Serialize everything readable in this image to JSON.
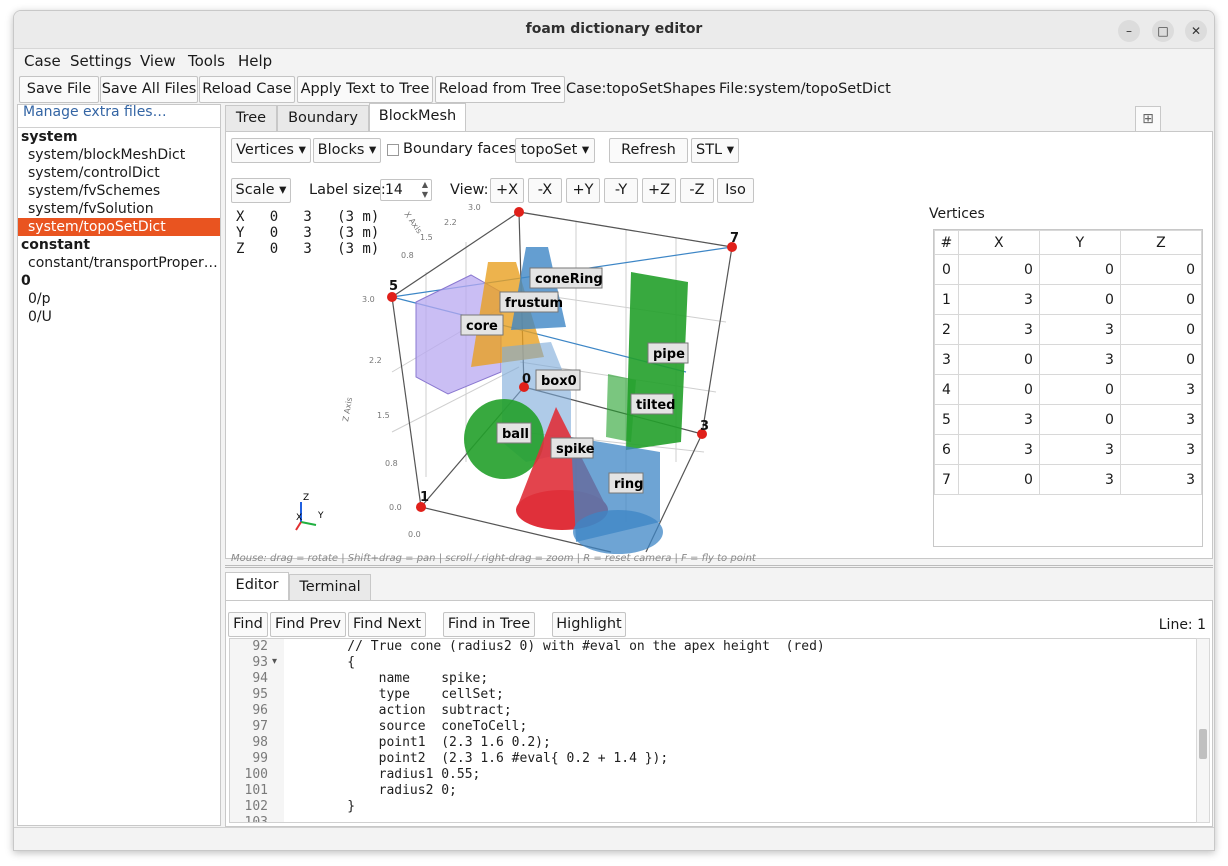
{
  "window": {
    "title": "foam dictionary editor"
  },
  "menu": [
    "Case",
    "Settings",
    "View",
    "Tools",
    "Help"
  ],
  "toolbar": {
    "buttons": [
      "Save File",
      "Save All Files",
      "Reload Case",
      "Apply Text to Tree",
      "Reload from Tree"
    ],
    "case_label": "Case:topoSetShapes",
    "file_label": "File:system/topoSetDict"
  },
  "sidebar": {
    "manage_link": "Manage extra files…",
    "items": [
      {
        "label": "system",
        "group": true
      },
      {
        "label": "system/blockMeshDict"
      },
      {
        "label": "system/controlDict"
      },
      {
        "label": "system/fvSchemes"
      },
      {
        "label": "system/fvSolution"
      },
      {
        "label": "system/topoSetDict",
        "selected": true
      },
      {
        "label": "constant",
        "group": true
      },
      {
        "label": "constant/transportProper…"
      },
      {
        "label": "0",
        "group": true
      },
      {
        "label": "0/p"
      },
      {
        "label": "0/U"
      }
    ]
  },
  "tabs": [
    "Tree",
    "Boundary",
    "BlockMesh"
  ],
  "blockmesh": {
    "vertices_btn": "Vertices ▾",
    "blocks_btn": "Blocks ▾",
    "boundary_faces": "Boundary faces",
    "toposet_btn": "topoSet ▾",
    "refresh_btn": "Refresh",
    "stl_btn": "STL ▾",
    "scale_btn": "Scale ▾",
    "label_size_label": "Label size:",
    "label_size_value": "14",
    "view_label": "View:",
    "view_buttons": [
      "+X",
      "-X",
      "+Y",
      "-Y",
      "+Z",
      "-Z",
      "Iso"
    ],
    "coords": [
      "X   0   3   (3 m)",
      "Y   0   3   (3 m)",
      "Z   0   3   (3 m)"
    ],
    "hint": "Mouse:  drag = rotate  |  Shift+drag = pan  |  scroll / right-drag = zoom  |  R = reset camera  |  F = fly to point",
    "shape_labels": [
      "coneRing",
      "frustum",
      "core",
      "pipe",
      "box0",
      "tilted",
      "ball",
      "spike",
      "ring"
    ],
    "vertex_markers": [
      "5",
      "7",
      "0",
      "3",
      "1"
    ],
    "axis_ticks": [
      "0.0",
      "0.8",
      "1.5",
      "2.2",
      "3.0",
      "0.0",
      "0.8",
      "1.5",
      "2.2",
      "3.0"
    ],
    "axis_names": [
      "Z Axis",
      "X Axis"
    ],
    "triad": {
      "z": "Z",
      "y": "Y",
      "x": "X"
    },
    "colors": {
      "red_shape": "#e0303a",
      "blue_shape": "#3d86c6",
      "green_shape": "#22a02a",
      "orange_shape": "#e8a020",
      "purple_box": "#b8a8f0"
    }
  },
  "vertices": {
    "title": "Vertices",
    "headers": [
      "#",
      "X",
      "Y",
      "Z"
    ],
    "rows": [
      [
        "0",
        "0",
        "0",
        "0"
      ],
      [
        "1",
        "3",
        "0",
        "0"
      ],
      [
        "2",
        "3",
        "3",
        "0"
      ],
      [
        "3",
        "0",
        "3",
        "0"
      ],
      [
        "4",
        "0",
        "0",
        "3"
      ],
      [
        "5",
        "3",
        "0",
        "3"
      ],
      [
        "6",
        "3",
        "3",
        "3"
      ],
      [
        "7",
        "0",
        "3",
        "3"
      ]
    ]
  },
  "editor_tabs": [
    "Editor",
    "Terminal"
  ],
  "editor": {
    "buttons": [
      "Find",
      "Find Prev",
      "Find Next",
      "Find in Tree",
      "Highlight"
    ],
    "line_info": "Line: 1",
    "lines": [
      {
        "n": "92",
        "t": "    // True cone (radius2 0) with #eval on the apex height  (red)"
      },
      {
        "n": "93",
        "t": "    {",
        "fold": "▾"
      },
      {
        "n": "94",
        "t": "        name    spike;"
      },
      {
        "n": "95",
        "t": "        type    cellSet;"
      },
      {
        "n": "96",
        "t": "        action  subtract;"
      },
      {
        "n": "97",
        "t": "        source  coneToCell;"
      },
      {
        "n": "98",
        "t": "        point1  (2.3 1.6 0.2);"
      },
      {
        "n": "99",
        "t": "        point2  (2.3 1.6 #eval{ 0.2 + 1.4 });"
      },
      {
        "n": "100",
        "t": "        radius1 0.55;"
      },
      {
        "n": "101",
        "t": "        radius2 0;"
      },
      {
        "n": "102",
        "t": "    }"
      },
      {
        "n": "103",
        "t": ""
      }
    ]
  }
}
